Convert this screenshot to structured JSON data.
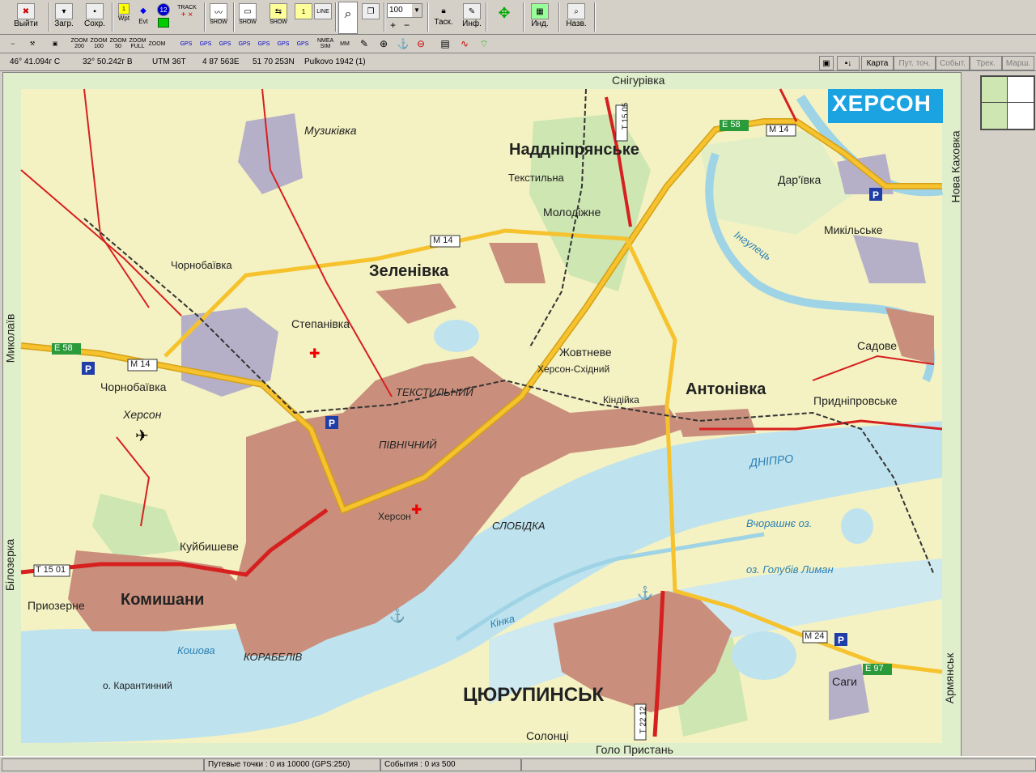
{
  "toolbar1": {
    "exit_label": "Выйти",
    "load_label": "Загр.",
    "save_label": "Сохр.",
    "wpt_label": "Wpt",
    "evt_label": "Evt",
    "track_label": "TRACK",
    "show_label": "SHOW",
    "zoom_value": "100",
    "task_label": "Таск.",
    "info_label": "Инф.",
    "ind_label": "Инд.",
    "name_label": "Назв."
  },
  "toolbar2": {
    "zoom200": "ZOOM 200",
    "zoom100": "ZOOM 100",
    "zoom50": "ZOOM 50",
    "zoomfull": "ZOOM FULL",
    "zoom_last": "ZOOM",
    "gps": "GPS",
    "nmea_sim": "NMEA SIM",
    "mm": "MM"
  },
  "coordbar": {
    "lat": "46° 41.094г С",
    "lon": "32° 50.242г В",
    "utm": "UTM  36T",
    "easting": "4 87 563E",
    "northing": "51 70 253N",
    "datum": "Pulkovo 1942 (1)"
  },
  "mode_tabs": [
    "Карта",
    "Пут. точ.",
    "Событ.",
    "Трек.",
    "Марш."
  ],
  "map": {
    "title": "ХЕРСОН",
    "edge_labels": {
      "top": "Снігурівка",
      "left_top": "Миколаїв",
      "left_bottom": "Білозерка",
      "right_top": "Нова Каховка",
      "right_bottom": "Армянськ",
      "bottom": "Голо Пристань"
    },
    "big_places": [
      "Наддніпрянське",
      "Зеленівка",
      "Антонівка",
      "Комишани",
      "ЦЮРУПИНСЬК"
    ],
    "places": [
      "Музиківка",
      "Текстильна",
      "Молодіжне",
      "Дар'ївка",
      "Микільське",
      "Чорнобаївка",
      "Степанівка",
      "Жовтневе",
      "Херсон-Східний",
      "Садове",
      "Кіндійка",
      "Придніпровське",
      "Херсон",
      "Куйбишеве",
      "Приозерне",
      "Саги",
      "Солонці",
      "ТЕКСТИЛЬНИЙ",
      "ПІВНІЧНИЙ",
      "СЛОБІДКА",
      "КОРАБЕЛІВ",
      "о. Карантинний"
    ],
    "water": [
      "ДНІПРО",
      "Інгулець",
      "Вчорашнє оз.",
      "оз. Голубів Лиман",
      "Кінка",
      "Кошова"
    ],
    "roads": [
      "M 14",
      "E 58",
      "T 15 05",
      "T 15 01",
      "M 24",
      "E 97",
      "T 22 12"
    ],
    "colors": {
      "land": "#f4f2c2",
      "water": "#bfe3ee",
      "city": "#c98f7c",
      "road_main": "#f6c22e",
      "road_red": "#d62020",
      "green": "#cde6b2",
      "title_bg": "#1aa3e0"
    }
  },
  "status": {
    "panel1": "",
    "waypoints": "Путевые точки : 0 из 10000  (GPS:250)",
    "events": "События : 0 из 500",
    "panel4": ""
  }
}
